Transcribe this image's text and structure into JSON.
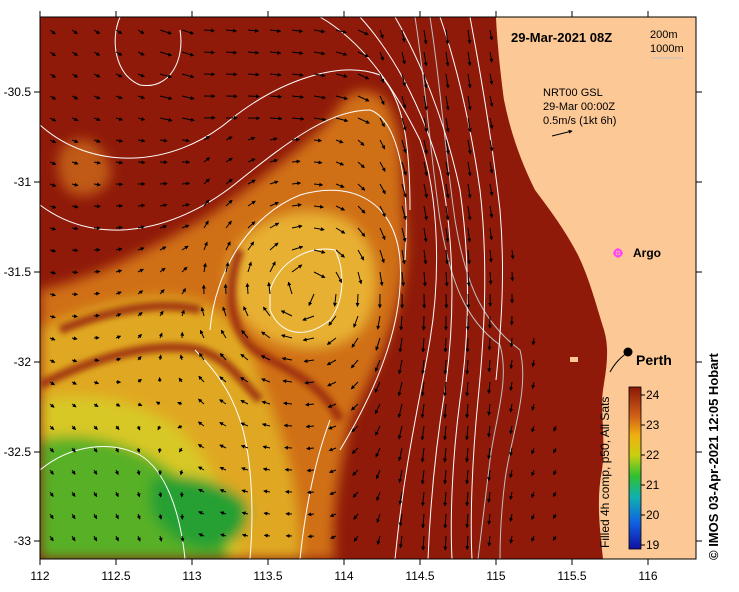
{
  "map": {
    "timestamp": "29-Mar-2021 08Z",
    "depth_contours": [
      "200m",
      "1000m"
    ],
    "current_source": "NRT00 GSL",
    "current_time": "29-Mar 00:00Z",
    "current_scale": "0.5m/s (1kt 6h)",
    "labels": {
      "argo": "Argo",
      "city": "Perth"
    },
    "x_ticks": [
      "112",
      "112.5",
      "113",
      "113.5",
      "114",
      "114.5",
      "115",
      "115.5",
      "116"
    ],
    "y_ticks": [
      "-30.5",
      "-31",
      "-31.5",
      "-32",
      "-32.5",
      "-33"
    ],
    "colorbar": {
      "ticks": [
        "24",
        "23",
        "22",
        "21",
        "20",
        "19"
      ],
      "label": "Filled 4h comp, p50, All Sats"
    },
    "credit": "© IMOS 03-Apr-2021 12:05 Hobart",
    "colors": {
      "warm_water": "#8f1a0a",
      "mid_water": "#d87a1a",
      "cool_water": "#e8c020",
      "cold_water": "#3fa020",
      "land": "#fcc896",
      "argo_marker": "#ff40ff"
    }
  }
}
